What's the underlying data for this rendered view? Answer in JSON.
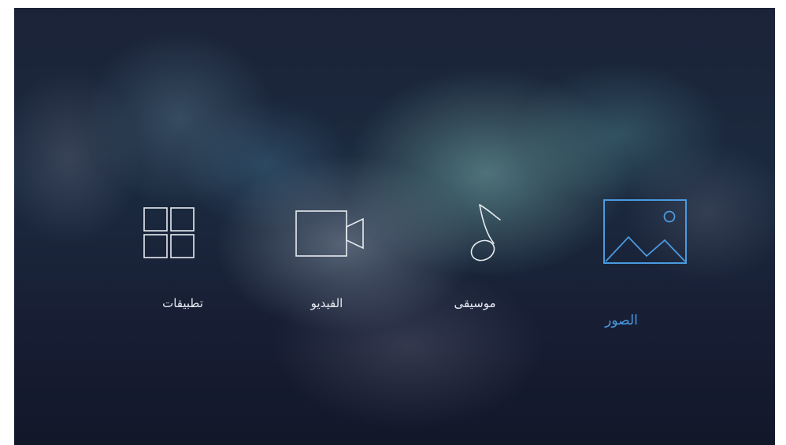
{
  "menu": {
    "items": [
      {
        "label": "تطبيقات",
        "icon": "apps-grid-icon",
        "selected": false
      },
      {
        "label": "الفيديو",
        "icon": "video-camera-icon",
        "selected": false
      },
      {
        "label": "موسيقى",
        "icon": "music-note-icon",
        "selected": false
      },
      {
        "label": "الصور",
        "icon": "picture-icon",
        "selected": true
      }
    ]
  },
  "colors": {
    "icon_default": "#e6ebf0",
    "selected_accent": "#4a9ae0",
    "background": "#121a2e"
  }
}
